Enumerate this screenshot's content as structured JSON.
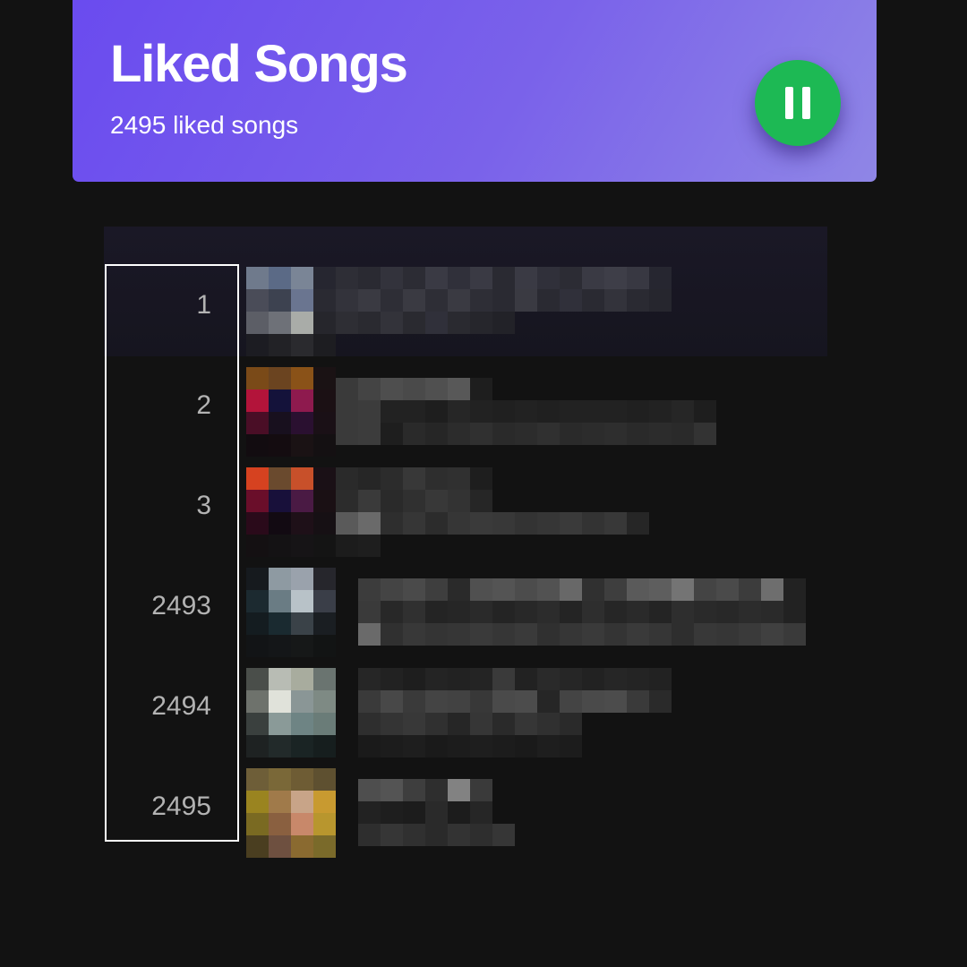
{
  "header": {
    "title": "Liked Songs",
    "count_label": "2495 liked songs",
    "play_state": "playing",
    "accent_color": "#1db954",
    "gradient_start": "#6a4bef",
    "gradient_end": "#8f86e6"
  },
  "tracks": [
    {
      "number": "1"
    },
    {
      "number": "2"
    },
    {
      "number": "3"
    },
    {
      "number": "2493"
    },
    {
      "number": "2494"
    },
    {
      "number": "2495"
    }
  ],
  "icons": {
    "play_button": "pause-icon"
  }
}
